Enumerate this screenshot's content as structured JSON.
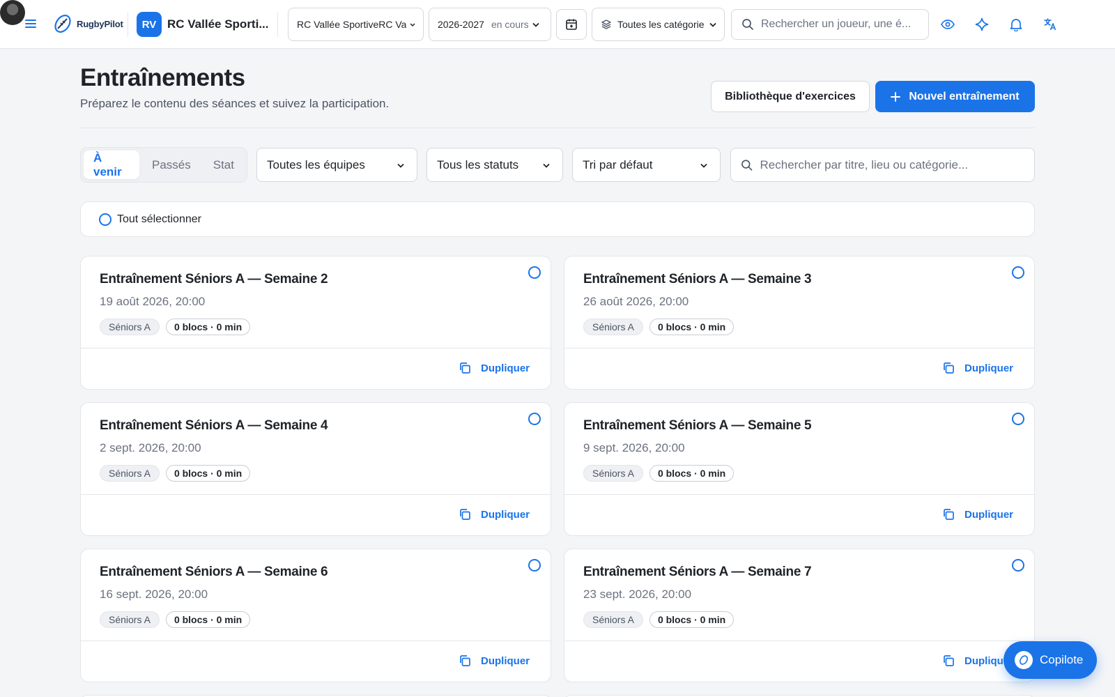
{
  "topbar": {
    "logo_text": "RugbyPilot",
    "club_initials": "RV",
    "club_name": "RC Vallée Sporti...",
    "club_select": "RC Vallée SportiveRC Val",
    "season": "2026-2027",
    "season_status": "en cours",
    "category_select": "Toutes les catégorie",
    "search_placeholder": "Rechercher un joueur, une é...",
    "icons": [
      "menu-icon",
      "calendar-add-icon",
      "layers-icon",
      "search-icon",
      "eye-icon",
      "sparkle-icon",
      "bell-icon",
      "translate-icon"
    ]
  },
  "header": {
    "title": "Entraînements",
    "subtitle": "Préparez le contenu des séances et suivez la participation.",
    "library_button": "Bibliothèque d'exercices",
    "new_button": "Nouvel entraînement"
  },
  "filters": {
    "tabs": [
      {
        "label": "À venir",
        "active": true
      },
      {
        "label": "Passés",
        "active": false
      },
      {
        "label": "Stat",
        "active": false
      }
    ],
    "team": "Toutes les équipes",
    "status": "Tous les statuts",
    "sort": "Tri par défaut",
    "search_placeholder": "Rechercher par titre, lieu ou catégorie..."
  },
  "select_all": "Tout sélectionner",
  "cards": [
    {
      "title": "Entraînement Séniors A — Semaine 2",
      "date": "19 août 2026, 20:00",
      "category": "Séniors A",
      "blocks": "0 blocs · 0 min",
      "action": "Dupliquer"
    },
    {
      "title": "Entraînement Séniors A — Semaine 3",
      "date": "26 août 2026, 20:00",
      "category": "Séniors A",
      "blocks": "0 blocs · 0 min",
      "action": "Dupliquer"
    },
    {
      "title": "Entraînement Séniors A — Semaine 4",
      "date": "2 sept. 2026, 20:00",
      "category": "Séniors A",
      "blocks": "0 blocs · 0 min",
      "action": "Dupliquer"
    },
    {
      "title": "Entraînement Séniors A — Semaine 5",
      "date": "9 sept. 2026, 20:00",
      "category": "Séniors A",
      "blocks": "0 blocs · 0 min",
      "action": "Dupliquer"
    },
    {
      "title": "Entraînement Séniors A — Semaine 6",
      "date": "16 sept. 2026, 20:00",
      "category": "Séniors A",
      "blocks": "0 blocs · 0 min",
      "action": "Dupliquer"
    },
    {
      "title": "Entraînement Séniors A — Semaine 7",
      "date": "23 sept. 2026, 20:00",
      "category": "Séniors A",
      "blocks": "0 blocs · 0 min",
      "action": "Dupliquer"
    }
  ],
  "copilote": "Copilote",
  "colors": {
    "accent": "#1b73e8",
    "text": "#1f2328",
    "muted": "#6b7280",
    "background": "#f4f5f7"
  }
}
